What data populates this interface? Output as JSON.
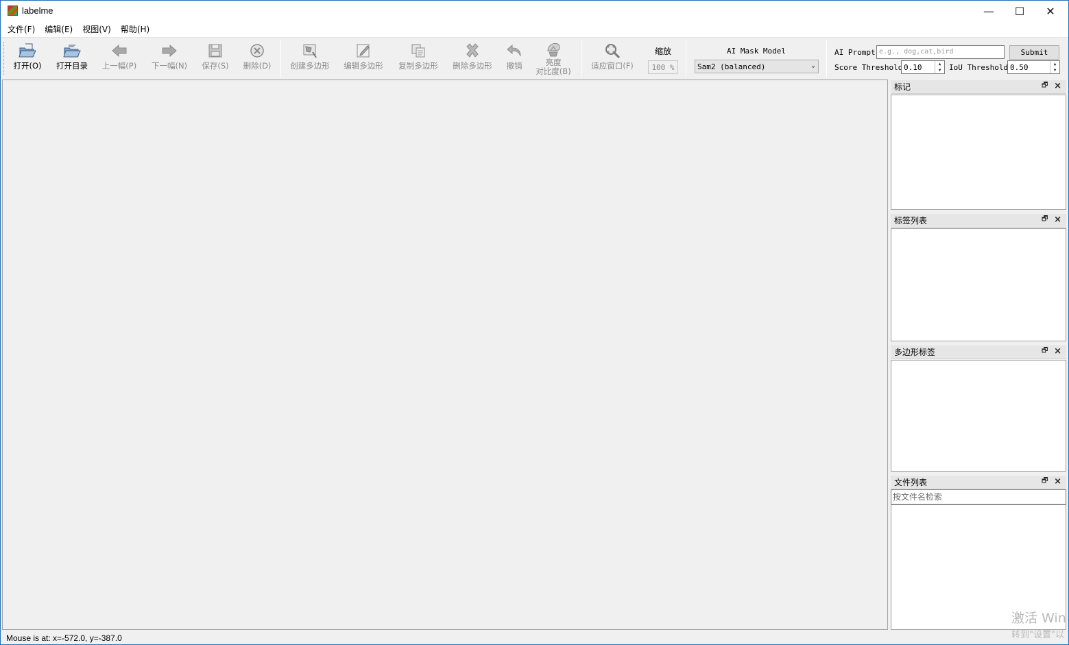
{
  "window": {
    "title": "labelme",
    "minimize": "—",
    "maximize": "☐",
    "close": "✕"
  },
  "menu": [
    "文件(F)",
    "编辑(E)",
    "视图(V)",
    "帮助(H)"
  ],
  "toolbar": {
    "open": "打开(O)",
    "open_dir": "打开目录",
    "prev": "上一幅(P)",
    "next": "下一幅(N)",
    "save": "保存(S)",
    "delete": "删除(D)",
    "create_polygon": "创建多边形",
    "edit_polygon": "编辑多边形",
    "copy_polygon": "复制多边形",
    "delete_polygon": "删除多边形",
    "undo": "撤销",
    "brightness_line1": "亮度",
    "brightness_line2": "对比度(B)",
    "fit_window": "适应窗口(F)",
    "zoom_label": "缩放",
    "zoom_value": "100 %",
    "ai_model_label": "AI Mask Model",
    "ai_model_value": "Sam2 (balanced)",
    "ai_prompt_label": "AI Prompt",
    "ai_prompt_placeholder": "e.g., dog,cat,bird",
    "submit": "Submit",
    "score_label": "Score Threshold",
    "score_value": "0.10",
    "iou_label": "IoU Threshold",
    "iou_value": "0.50"
  },
  "docks": {
    "flags": "标记",
    "label_list": "标签列表",
    "polygon_labels": "多边形标签",
    "file_list": "文件列表",
    "file_search_placeholder": "按文件名检索"
  },
  "status": "Mouse is at: x=-572.0, y=-387.0",
  "watermark": {
    "line1": "激活 Win",
    "line2": "转到\"设置\"以"
  },
  "colors": {
    "enabled_icon": "#5b7fa8",
    "disabled_icon": "#9b9b9b",
    "window_border": "#1f6fb6"
  }
}
